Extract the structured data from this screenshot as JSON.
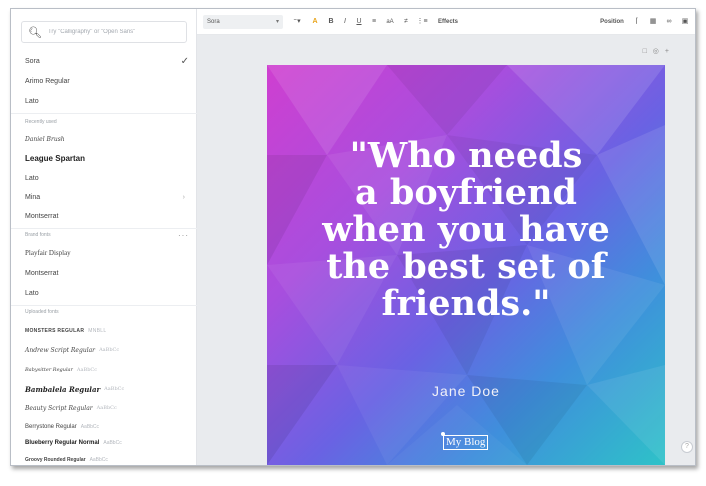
{
  "font_panel": {
    "search_placeholder": "Try \"Calligraphy\" or \"Open Sans\"",
    "top_fonts": [
      {
        "label": "Sora"
      },
      {
        "label": "Arimo Regular"
      },
      {
        "label": "Lato"
      }
    ],
    "recently_used": {
      "heading": "Recently used",
      "items": [
        {
          "label": "Daniel Brush"
        },
        {
          "label": "League Spartan"
        },
        {
          "label": "Lato"
        },
        {
          "label": "Mina"
        },
        {
          "label": "Montserrat"
        }
      ]
    },
    "brand_fonts": {
      "heading": "Brand fonts",
      "items": [
        {
          "label": "Playfair Display"
        },
        {
          "label": "Montserrat"
        },
        {
          "label": "Lato"
        }
      ]
    },
    "uploaded_fonts": {
      "heading": "Uploaded fonts",
      "items": [
        {
          "label": "MONSTERS REGULAR",
          "preview": "MNBLL"
        },
        {
          "label": "Andrew Script Regular",
          "preview": "AaBbCc"
        },
        {
          "label": "Babysitter Regular",
          "preview": "AaBbCc"
        },
        {
          "label": "Bambalela Regular",
          "preview": "AaBbCc"
        },
        {
          "label": "Beauty Script Regular",
          "preview": "AaBbCc"
        },
        {
          "label": "Berrystone Regular",
          "preview": "AaBbCc"
        },
        {
          "label": "Blueberry Regular Normal",
          "preview": "AaBbCc"
        },
        {
          "label": "Groovy Rounded Regular",
          "preview": "AaBbCc"
        }
      ]
    }
  },
  "toolbar": {
    "font_name": "Sora",
    "effects_label": "Effects",
    "position_label": "Position"
  },
  "design": {
    "quote_lines": [
      "\"Who needs",
      "a boyfriend",
      "when you have",
      "the best set of",
      "friends.\""
    ],
    "author": "Jane Doe",
    "blog_label": "My Blog"
  },
  "colors": {
    "gradient_start": "#cf3fd0",
    "gradient_mid": "#6a62e3",
    "gradient_end": "#2ec2c8"
  }
}
